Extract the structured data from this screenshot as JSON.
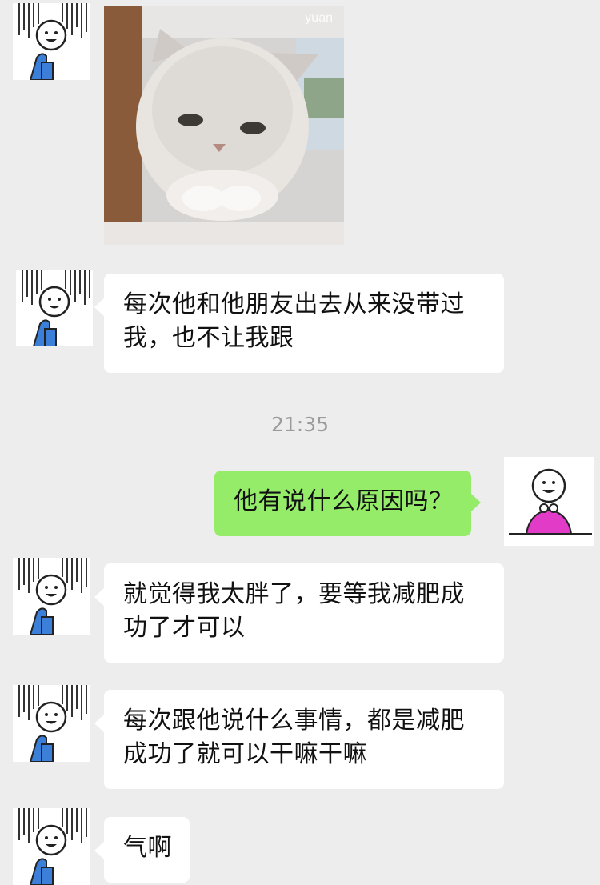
{
  "image_message": {
    "watermark": "yuan"
  },
  "messages": [
    {
      "side": "left",
      "text": "每次他和他朋友出去从来没带过我，也不让我跟"
    },
    {
      "side": "right",
      "text": "他有说什么原因吗？"
    },
    {
      "side": "left",
      "text": "就觉得我太胖了，要等我减肥成功了才可以"
    },
    {
      "side": "left",
      "text": "每次跟他说什么事情，都是减肥成功了就可以干嘛干嘛"
    },
    {
      "side": "left",
      "text": "气啊"
    }
  ],
  "timestamp": "21:35",
  "colors": {
    "background": "#ededed",
    "bubble_left": "#ffffff",
    "bubble_right": "#95ec69",
    "timestamp": "#9b9b9b",
    "avatar_left_shirt": "#3b7fd8",
    "avatar_right_shirt": "#e23bc8"
  }
}
